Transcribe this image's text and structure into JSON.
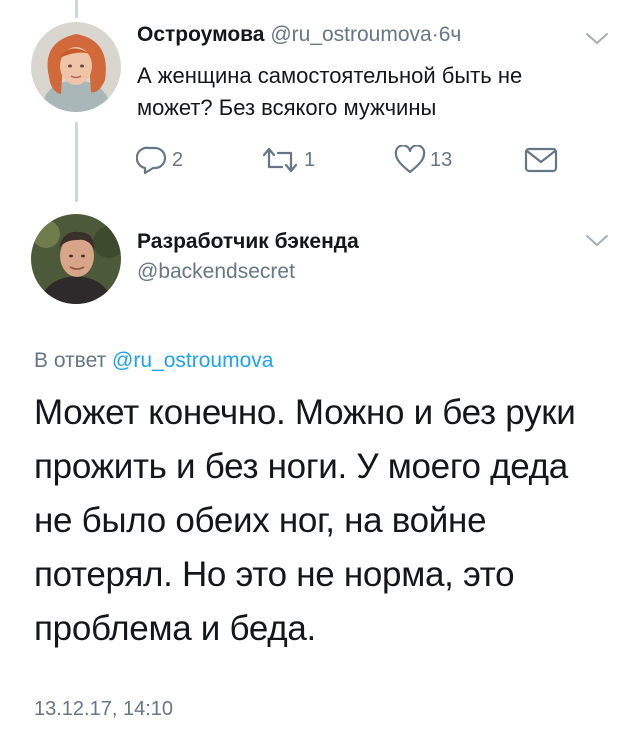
{
  "colors": {
    "text": "#14171a",
    "secondary": "#657786",
    "link": "#1da1f2",
    "thread_line": "#ccd6dd"
  },
  "parent_tweet": {
    "display_name": "Остроумова",
    "handle": "@ru_ostroumova",
    "separator": "·",
    "time_ago": "6ч",
    "text": "А женщина самостоятельной быть не может? Без всякого мужчины",
    "actions": {
      "reply_icon": "reply-icon",
      "reply_count": "2",
      "retweet_icon": "retweet-icon",
      "retweet_count": "1",
      "like_icon": "heart-icon",
      "like_count": "13",
      "message_icon": "envelope-icon"
    },
    "menu_icon": "chevron-down-icon"
  },
  "main_tweet": {
    "display_name": "Разработчик бэкенда",
    "handle": "@backendsecret",
    "menu_icon": "chevron-down-icon",
    "reply_prefix": "В ответ",
    "reply_handle": "@ru_ostroumova",
    "text": "Может конечно. Можно и без руки прожить и без ноги. У моего деда не было обеих ног, на войне потерял. Но это не норма, это проблема и беда.",
    "timestamp": "13.12.17, 14:10"
  }
}
